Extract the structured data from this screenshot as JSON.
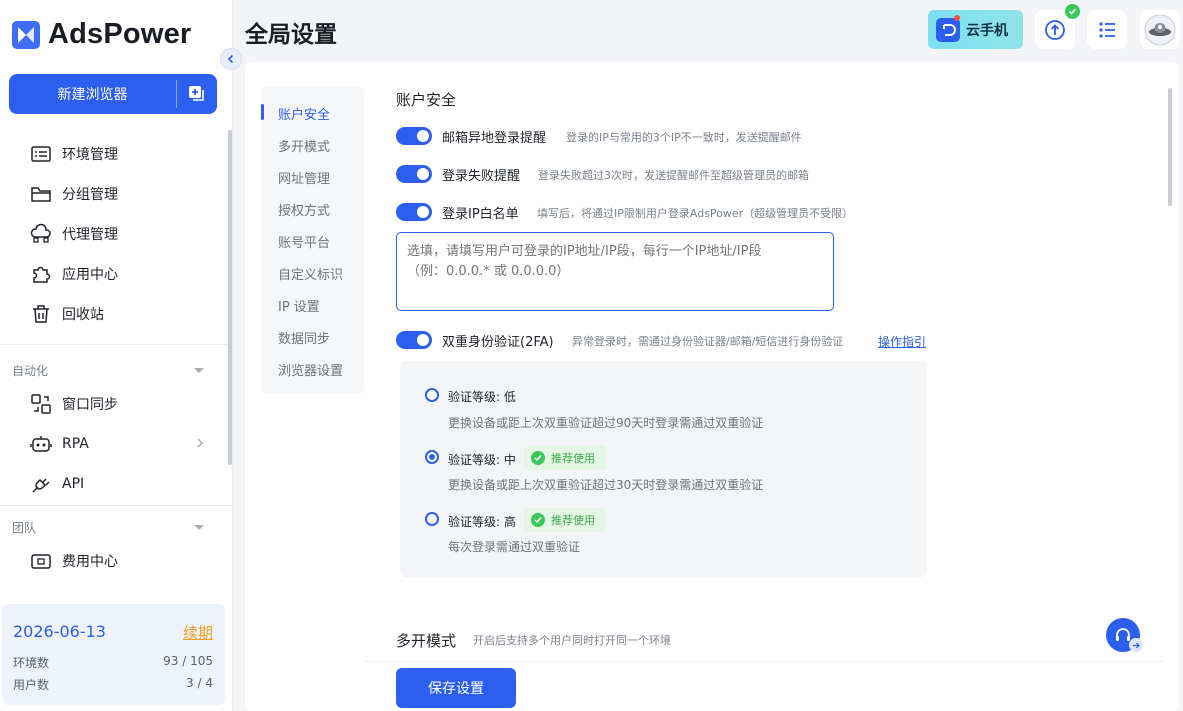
{
  "brand": {
    "name": "AdsPower",
    "accent": "#2c5ff0"
  },
  "sidebar": {
    "new_browser_label": "新建浏览器",
    "items": [
      {
        "label": "环境管理",
        "icon": "environment-list-icon"
      },
      {
        "label": "分组管理",
        "icon": "folder-icon"
      },
      {
        "label": "代理管理",
        "icon": "proxy-cloud-icon"
      },
      {
        "label": "应用中心",
        "icon": "puzzle-icon"
      },
      {
        "label": "回收站",
        "icon": "trash-icon"
      }
    ],
    "automation_label": "自动化",
    "automation_items": [
      {
        "label": "窗口同步",
        "icon": "window-sync-icon"
      },
      {
        "label": "RPA",
        "icon": "robot-icon"
      },
      {
        "label": "API",
        "icon": "plug-icon"
      }
    ],
    "team_label": "团队",
    "team_items": [
      {
        "label": "费用中心",
        "icon": "wallet-icon"
      }
    ],
    "info_card": {
      "date": "2026-06-13",
      "renew_label": "续期",
      "env_label": "环境数",
      "env_value": "93 / 105",
      "user_label": "用户数",
      "user_value": "3 / 4"
    }
  },
  "header": {
    "title": "全局设置",
    "cloud_phone_label": "云手机"
  },
  "subnav": {
    "items": [
      "账户安全",
      "多开模式",
      "网址管理",
      "授权方式",
      "账号平台",
      "自定义标识",
      "IP 设置",
      "数据同步",
      "浏览器设置"
    ],
    "active_index": 0
  },
  "account_security": {
    "title": "账户安全",
    "options": [
      {
        "label": "邮箱异地登录提醒",
        "desc": "登录的IP与常用的3个IP不一致时，发送提醒邮件",
        "enabled": true
      },
      {
        "label": "登录失败提醒",
        "desc": "登录失败超过3次时，发送提醒邮件至超级管理员的邮箱",
        "enabled": true
      },
      {
        "label": "登录IP白名单",
        "desc": "填写后，将通过IP限制用户登录AdsPower（超级管理员不受限）",
        "enabled": true
      },
      {
        "label": "双重身份验证(2FA)",
        "desc": "异常登录时，需通过身份验证器/邮箱/短信进行身份验证",
        "enabled": true
      }
    ],
    "ip_placeholder": "选填，请填写用户可登录的IP地址/IP段，每行一个IP地址/IP段\n（例：0.0.0.* 或 0.0.0.0）",
    "guide_link": "操作指引",
    "twofa_levels": [
      {
        "label": "验证等级: 低",
        "desc": "更换设备或距上次双重验证超过90天时登录需通过双重验证",
        "checked": false,
        "recommended": false
      },
      {
        "label": "验证等级: 中",
        "desc": "更换设备或距上次双重验证超过30天时登录需通过双重验证",
        "checked": true,
        "recommended": true
      },
      {
        "label": "验证等级: 高",
        "desc": "每次登录需通过双重验证",
        "checked": false,
        "recommended": true
      }
    ],
    "recommend_label": "推荐使用"
  },
  "multi_open": {
    "title": "多开模式",
    "desc": "开启后支持多个用户同时打开同一个环境"
  },
  "save_label": "保存设置"
}
